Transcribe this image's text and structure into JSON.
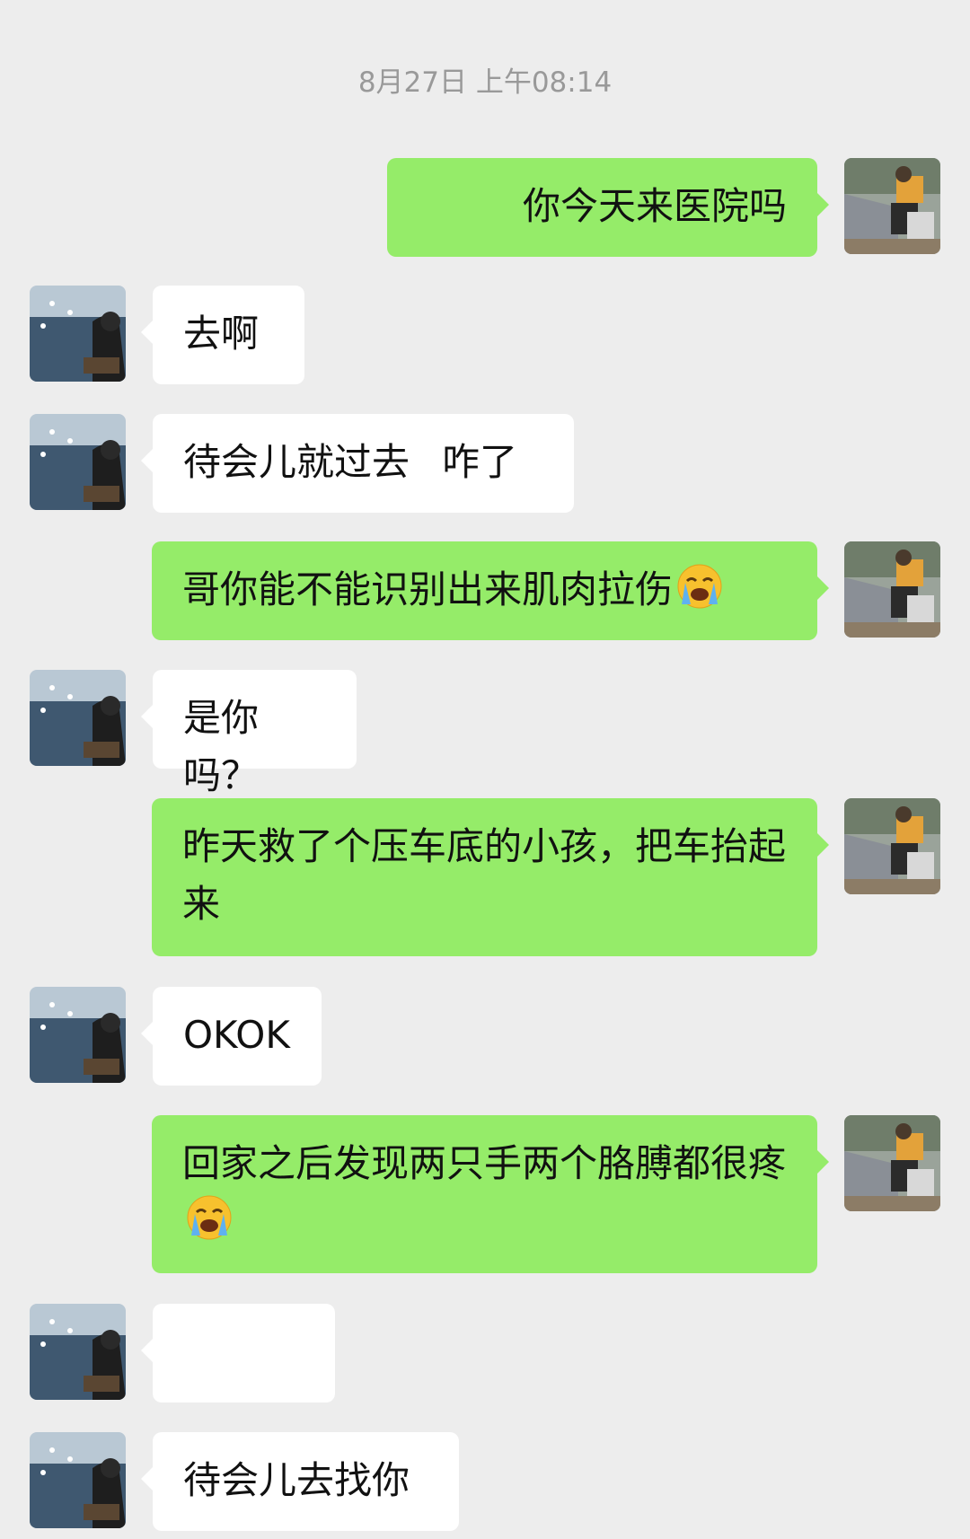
{
  "chat": {
    "timestamp": "8月27日 上午08:14",
    "messages": [
      {
        "side": "right",
        "text": "你今天来医院吗"
      },
      {
        "side": "left",
        "text": "去啊"
      },
      {
        "side": "left",
        "text_a": "待会儿就过去",
        "text_b": "咋了"
      },
      {
        "side": "right",
        "text": "哥你能不能识别出来肌肉拉伤",
        "emoji": "loudly-crying-face"
      },
      {
        "side": "left",
        "text": "是你吗？"
      },
      {
        "side": "right",
        "text": "昨天救了个压车底的小孩，把车抬起来"
      },
      {
        "side": "left",
        "text": "OKOK"
      },
      {
        "side": "right",
        "text": "回家之后发现两只手两个胳膊都很疼",
        "emoji": "loudly-crying-face"
      },
      {
        "side": "left",
        "text": ""
      },
      {
        "side": "left",
        "text": "待会儿去找你"
      }
    ]
  },
  "colors": {
    "background": "#ededed",
    "sent_bubble": "#95ec69",
    "received_bubble": "#ffffff",
    "timestamp_text": "#999999"
  }
}
